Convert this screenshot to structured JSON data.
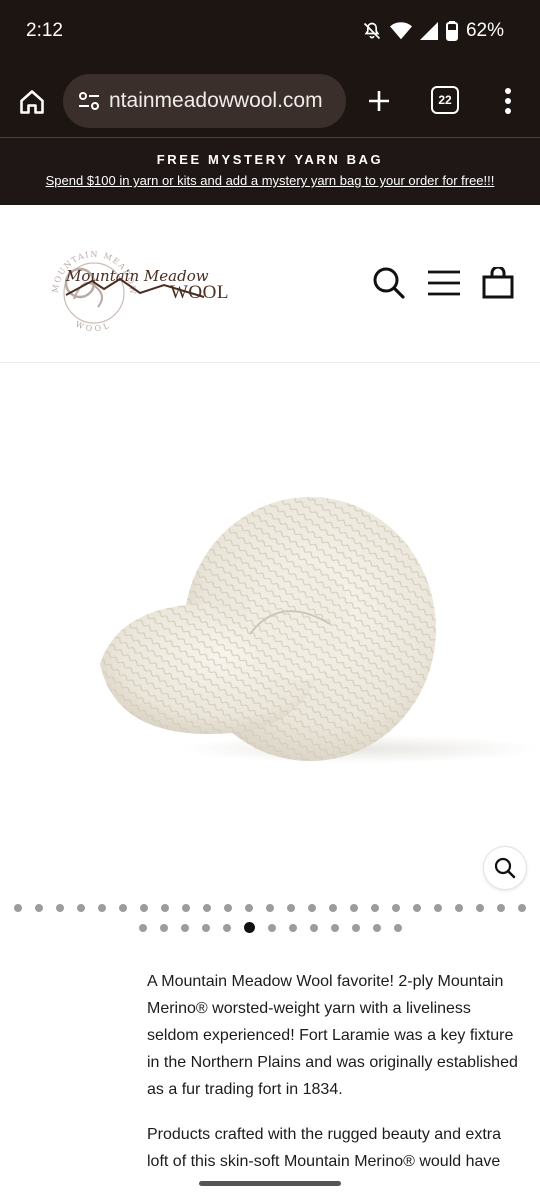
{
  "status_bar": {
    "time": "2:12",
    "battery": "62%",
    "icons": [
      "mute-icon",
      "wifi-icon",
      "signal-icon",
      "battery-icon"
    ]
  },
  "browser": {
    "url": "ntainmeadowwool.com",
    "tab_count": "22",
    "icons": [
      "home-icon",
      "site-settings-icon",
      "plus-icon",
      "tabs-icon",
      "more-vert-icon"
    ]
  },
  "announcement": {
    "title": "FREE MYSTERY YARN BAG",
    "link_text": "Spend $100 in yarn or kits and add a mystery yarn bag to your order for free!!!"
  },
  "header": {
    "logo": {
      "script_text": "Mountain Meadow",
      "wordmark": "WOOL",
      "ring_top": "MOUNTAIN MEADOW",
      "ring_bottom": "WOOL"
    },
    "icons": [
      "search-icon",
      "hamburger-menu-icon",
      "shopping-bag-icon"
    ]
  },
  "product_gallery": {
    "image_alt": "skein of natural white yarn",
    "dot_rows": [
      25,
      13
    ],
    "active_dot_row": 1,
    "active_dot_index": 5
  },
  "description": {
    "paragraphs": [
      " A Mountain Meadow Wool favorite! 2-ply Mountain Merino® worsted-weight yarn with a liveliness seldom experienced!  Fort Laramie was a key fixture in the Northern Plains and was originally established as a fur trading fort in 1834.",
      "Products crafted with the rugged beauty and extra loft of this skin-soft Mountain Merino® would have"
    ]
  },
  "colors": {
    "browser_bg": "#1d1512",
    "url_pill": "#3a2f2b",
    "announcement_bg": "#1f1715",
    "logo_brown": "#4a2e22",
    "logo_gray": "#b9aaa5",
    "yarn": "#eeeadf"
  }
}
